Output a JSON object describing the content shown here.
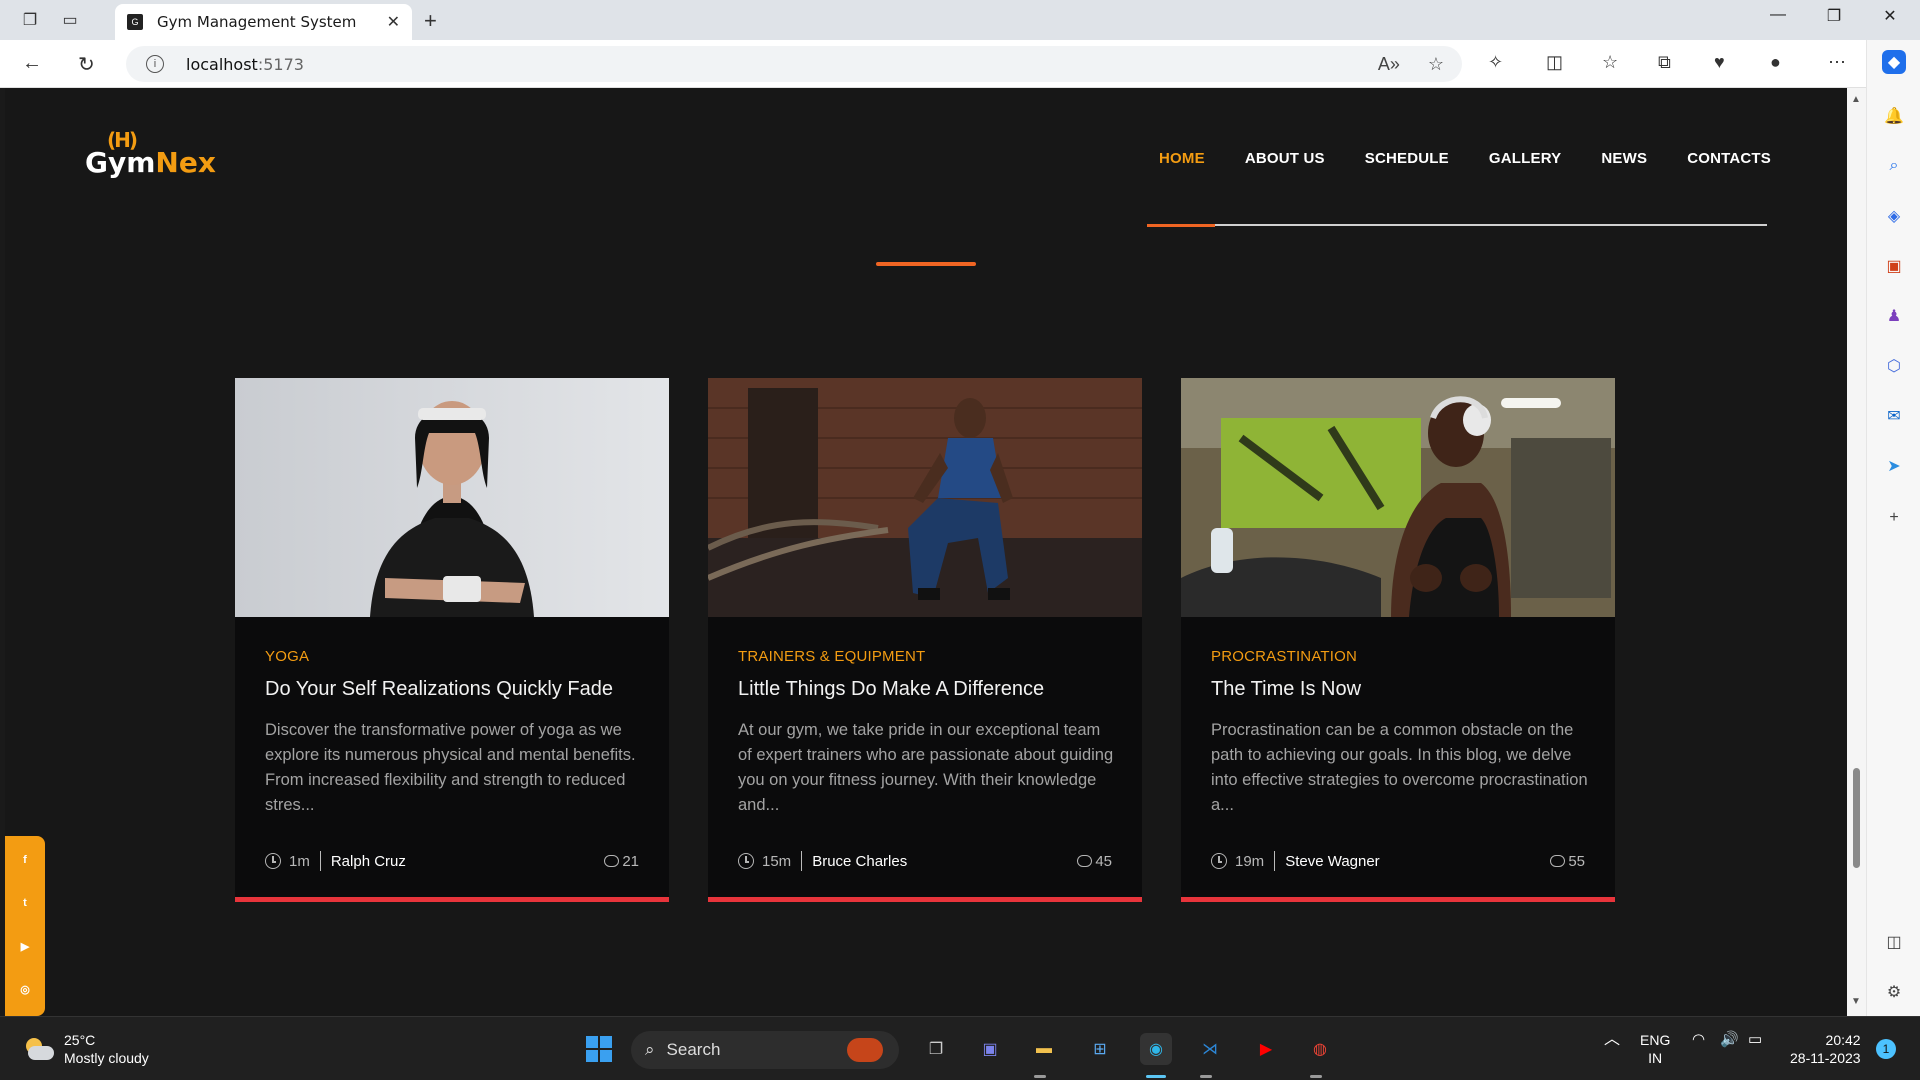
{
  "browser": {
    "tab_title": "Gym Management System",
    "url_host": "localhost",
    "url_port": ":5173"
  },
  "site": {
    "logo_gym": "Gym",
    "logo_nex": "Nex",
    "logo_mark": "(H)",
    "nav": [
      "HOME",
      "ABOUT US",
      "SCHEDULE",
      "GALLERY",
      "NEWS",
      "CONTACTS"
    ],
    "active_nav": "HOME"
  },
  "cards": [
    {
      "category": "YOGA",
      "title": "Do Your Self Realizations Quickly Fade",
      "excerpt": "Discover the transformative power of yoga as we explore its numerous physical and mental benefits. From increased flexibility and strength to reduced stres...",
      "time": "1m",
      "author": "Ralph Cruz",
      "comments": "21"
    },
    {
      "category": "TRAINERS & EQUIPMENT",
      "title": "Little Things Do Make A Difference",
      "excerpt": "At our gym, we take pride in our exceptional team of expert trainers who are passionate about guiding you on your fitness journey. With their knowledge and...",
      "time": "15m",
      "author": "Bruce Charles",
      "comments": "45"
    },
    {
      "category": "PROCRASTINATION",
      "title": "The Time Is Now",
      "excerpt": "Procrastination can be a common obstacle on the path to achieving our goals. In this blog, we delve into effective strategies to overcome procrastination a...",
      "time": "19m",
      "author": "Steve Wagner",
      "comments": "55"
    }
  ],
  "taskbar": {
    "temp": "25°C",
    "weather": "Mostly cloudy",
    "search": "Search",
    "lang1": "ENG",
    "lang2": "IN",
    "time": "20:42",
    "date": "28-11-2023",
    "notif_count": "1"
  },
  "colors": {
    "accent": "#f39c12",
    "accent_red": "#e8343b",
    "page_bg": "#171717",
    "card_bg": "#0b0b0c"
  }
}
